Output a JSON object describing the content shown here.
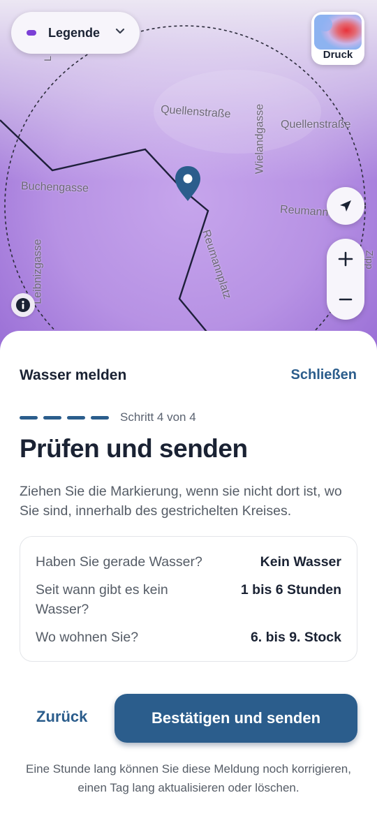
{
  "map": {
    "legend_label": "Legende",
    "druck_label": "Druck",
    "streets": {
      "quellenstrasse_1": "Quellenstraße",
      "quellenstrasse_2": "Quellenstraße",
      "buchengasse": "Buchengasse",
      "wielandgasse": "Wielandgasse",
      "reumann": "Reumann",
      "reumannplatz": "Reumannplatz",
      "leibnizgasse": "Leibnizgasse",
      "edge_right": "Zipp",
      "edge_top": "L"
    },
    "colors": {
      "overlay": "#9a6fd6",
      "pin": "#2b5d8c",
      "accent": "#7b3fd6"
    },
    "icons": {
      "legend_chevron": "chevron-down-icon",
      "locate": "navigation-arrow-icon",
      "zoom_in": "plus-icon",
      "zoom_out": "minus-icon",
      "info": "info-icon",
      "pin": "location-pin-icon"
    }
  },
  "sheet": {
    "title": "Wasser melden",
    "close_label": "Schließen",
    "step_label": "Schritt 4 von 4",
    "progress": {
      "current": 4,
      "total": 4
    },
    "heading": "Prüfen und senden",
    "description": "Ziehen Sie die Markierung, wenn sie nicht dort ist, wo Sie sind, innerhalb des gestrichelten Kreises.",
    "summary": [
      {
        "question": "Haben Sie gerade Wasser?",
        "answer": "Kein Wasser"
      },
      {
        "question": "Seit wann gibt es kein Wasser?",
        "answer": "1 bis 6 Stunden"
      },
      {
        "question": "Wo wohnen Sie?",
        "answer": "6. bis 9. Stock"
      }
    ],
    "back_label": "Zurück",
    "submit_label": "Bestätigen und senden",
    "footnote": "Eine Stunde lang können Sie diese Meldung noch korrigieren, einen Tag lang aktualisieren oder löschen."
  },
  "theme": {
    "primary": "#2b5d8c",
    "text": "#1a2233",
    "muted": "#555c66"
  }
}
